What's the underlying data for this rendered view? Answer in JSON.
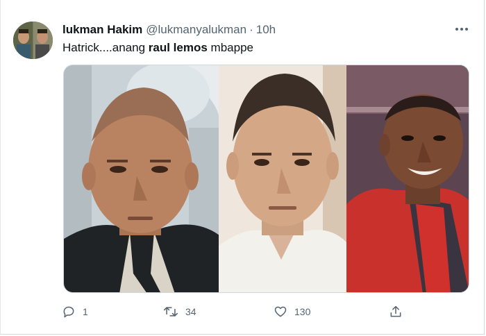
{
  "tweet": {
    "author_name": "lukman Hakim",
    "author_handle": "@lukmanyalukman",
    "separator": "·",
    "time": "10h",
    "text_prefix": "Hatrick....anang ",
    "text_bold": "raul lemos",
    "text_suffix": " mbappe",
    "avatar_icon": "profile-photo",
    "more_icon": "more-dots-icon"
  },
  "media": {
    "photos": [
      {
        "name": "photo-left"
      },
      {
        "name": "photo-middle"
      },
      {
        "name": "photo-right"
      }
    ]
  },
  "actions": {
    "reply_count": "1",
    "retweet_count": "34",
    "like_count": "130",
    "colors": {
      "icon": "#536471",
      "text": "#536471"
    }
  }
}
